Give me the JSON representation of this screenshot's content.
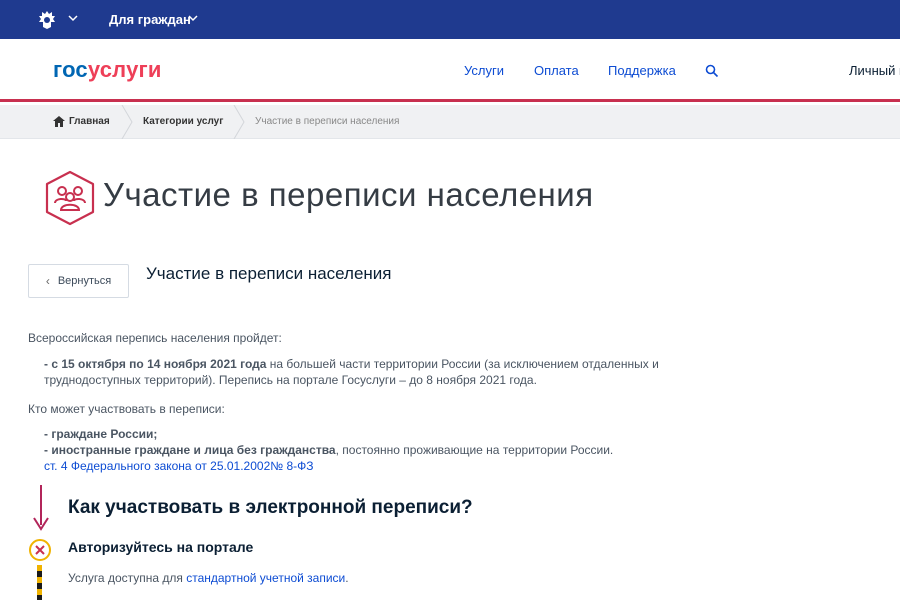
{
  "topbar": {
    "for_citizens": "Для граждан"
  },
  "header": {
    "logo_part1": "гос",
    "logo_part2": "услуги",
    "nav": [
      "Услуги",
      "Оплата",
      "Поддержка"
    ],
    "account": "Личный к"
  },
  "breadcrumb": {
    "home": "Главная",
    "categories": "Категории услуг",
    "current": "Участие в переписи населения"
  },
  "page": {
    "title": "Участие в переписи населения",
    "back_label": "Вернуться",
    "service_title": "Участие в переписи населения",
    "intro": "Всероссийская перепись населения пройдет:",
    "dates_bold": "- с 15 октября по 14 ноября 2021 года",
    "dates_rest": " на большей части территории России (за исключением отдаленных и",
    "dates_line2": "труднодоступных территорий). Перепись на портале Госуслуги – до 8 ноября 2021 года.",
    "who_intro": "Кто может участвовать в переписи:",
    "who_item1": "- граждане России;",
    "who_item2_bold": "- иностранные граждане и лица без гражданства",
    "who_item2_rest": ", постоянно проживающие на территории России.",
    "law_link": "ст. 4 Федерального закона от 25.01.2002№ 8-ФЗ"
  },
  "how": {
    "title": "Как участвовать в электронной переписи?",
    "step_title": "Авторизуйтесь на портале",
    "step_desc_prefix": "Услуга доступна для ",
    "step_desc_link": "стандартной учетной записи",
    "step_desc_suffix": "."
  },
  "colors": {
    "topbar": "#1f3a8f",
    "brand_blue": "#0066b3",
    "brand_red": "#ee3f58",
    "accent": "#c8304f",
    "link": "#0d4cd3"
  }
}
